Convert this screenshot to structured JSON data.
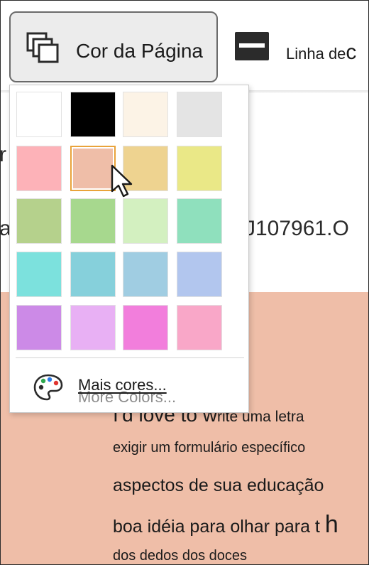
{
  "ribbon": {
    "page_color_label": "Cor da Página",
    "borders_label": "Linha de",
    "borders_overflow": "c"
  },
  "document": {
    "left_fragments": [
      "r",
      "a"
    ],
    "code_fragment": "J107961.O",
    "lines": [
      {
        "ghost": "I'd love to w",
        "text": "rite uma letra"
      },
      {
        "text": "exigir um formulário específico"
      },
      {
        "text": "aspectos de sua educação"
      },
      {
        "text": "boa idéia para olhar para t",
        "tail": "h"
      },
      {
        "text": "dos dedos dos doces"
      }
    ],
    "background_color": "#efbea8"
  },
  "dropdown": {
    "swatches": [
      [
        "#ffffff",
        "#000000",
        "#fcf3e6",
        "#e4e4e4"
      ],
      [
        "#fdb2b8",
        "#efbea8",
        "#eed390",
        "#eae887"
      ],
      [
        "#b5d18c",
        "#a7d88e",
        "#d3f0c0",
        "#8fe0bd"
      ],
      [
        "#7ce1dd",
        "#86d0db",
        "#a0cde2",
        "#b2c6ee"
      ],
      [
        "#cc8ae7",
        "#e8b0f4",
        "#f27edc",
        "#f9a7c8"
      ]
    ],
    "selected_swatch": "#efbea8",
    "more_colors_label": "Mais cores...",
    "more_colors_ghost": "More Colors..."
  },
  "icons": {
    "page_color": "page-color-icon",
    "borders": "page-borders-icon",
    "palette": "palette-icon",
    "cursor": "mouse-pointer-icon"
  }
}
